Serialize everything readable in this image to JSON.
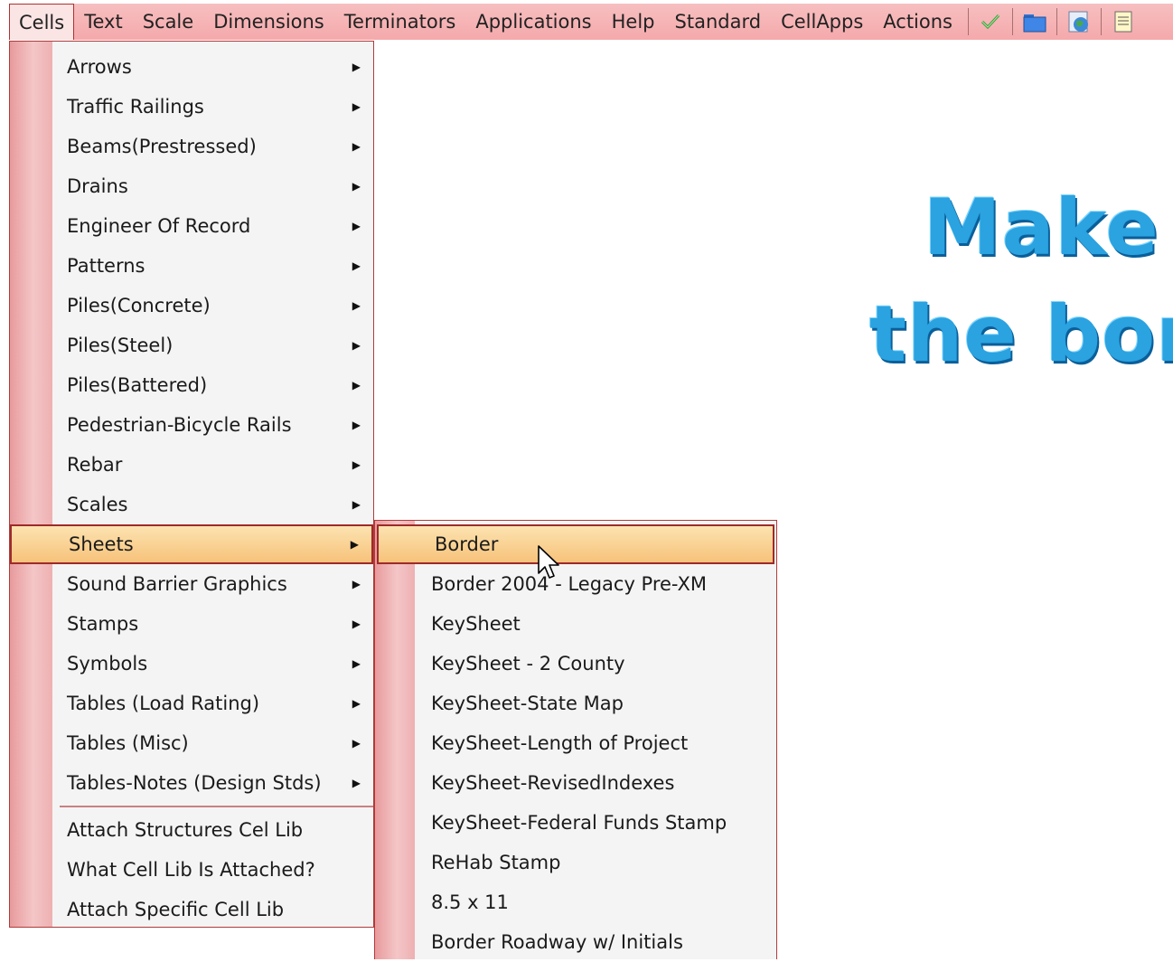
{
  "menubar": {
    "items": [
      "Cells",
      "Text",
      "Scale",
      "Dimensions",
      "Terminators",
      "Applications",
      "Help",
      "Standard",
      "CellApps",
      "Actions"
    ],
    "icons": [
      "checkmark-icon",
      "folder-icon",
      "globe-icon",
      "notepad-icon"
    ]
  },
  "cells_menu": {
    "items": [
      {
        "label": "Arrows",
        "submenu": true
      },
      {
        "label": "Traffic Railings",
        "submenu": true
      },
      {
        "label": "Beams(Prestressed)",
        "submenu": true
      },
      {
        "label": "Drains",
        "submenu": true
      },
      {
        "label": "Engineer Of Record",
        "submenu": true
      },
      {
        "label": "Patterns",
        "submenu": true
      },
      {
        "label": "Piles(Concrete)",
        "submenu": true
      },
      {
        "label": "Piles(Steel)",
        "submenu": true
      },
      {
        "label": "Piles(Battered)",
        "submenu": true
      },
      {
        "label": "Pedestrian-Bicycle Rails",
        "submenu": true
      },
      {
        "label": "Rebar",
        "submenu": true
      },
      {
        "label": "Scales",
        "submenu": true
      },
      {
        "label": "Sheets",
        "submenu": true,
        "highlighted": true
      },
      {
        "label": "Sound Barrier Graphics",
        "submenu": true
      },
      {
        "label": "Stamps",
        "submenu": true
      },
      {
        "label": "Symbols",
        "submenu": true
      },
      {
        "label": "Tables (Load Rating)",
        "submenu": true
      },
      {
        "label": "Tables (Misc)",
        "submenu": true
      },
      {
        "label": "Tables-Notes (Design Stds)",
        "submenu": true
      }
    ],
    "actions": [
      "Attach Structures Cel Lib",
      "What Cell Lib Is Attached?",
      "Attach Specific Cell Lib"
    ]
  },
  "sheets_menu": {
    "items": [
      {
        "label": "Border",
        "highlighted": true
      },
      {
        "label": "Border 2004 - Legacy Pre-XM"
      },
      {
        "label": "KeySheet"
      },
      {
        "label": "KeySheet - 2 County"
      },
      {
        "label": "KeySheet-State Map"
      },
      {
        "label": "KeySheet-Length of Project"
      },
      {
        "label": "KeySheet-RevisedIndexes"
      },
      {
        "label": "KeySheet-Federal Funds Stamp"
      },
      {
        "label": "ReHab Stamp"
      },
      {
        "label": "8.5 x 11"
      },
      {
        "label": "Border Roadway w/ Initials"
      }
    ]
  },
  "background_text": {
    "line1": "Make",
    "line2": "the bor"
  },
  "colors": {
    "menubar": "#f5a9ab",
    "highlight": "#f7c27a",
    "big_text": "#2aa3e0"
  }
}
